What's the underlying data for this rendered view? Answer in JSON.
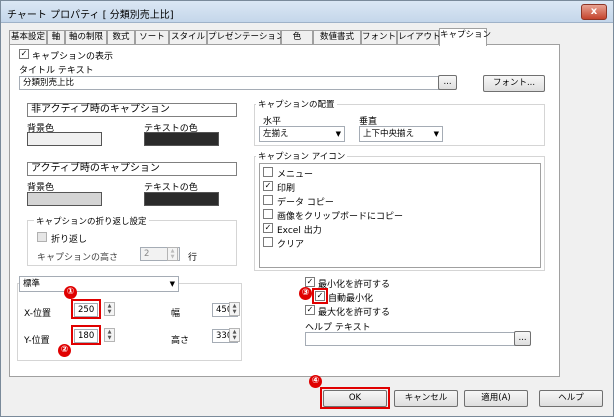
{
  "window": {
    "title": "チャート プロパティ [ 分類別売上比]",
    "close": "x"
  },
  "tabs": [
    "基本設定",
    "軸",
    "軸の制限",
    "数式",
    "ソート",
    "スタイル",
    "プレゼンテーション",
    "色",
    "数値書式",
    "フォント",
    "レイアウト",
    "キャプション"
  ],
  "caption": {
    "show_caption_label": "キャプションの表示",
    "show_caption_checked": "✓",
    "title_text_label": "タイトル テキスト",
    "title_text_value": "分類別売上比",
    "browse": "...",
    "font_button": "フォント..."
  },
  "inactive": {
    "heading": "非アクティブ時のキャプション",
    "bg_label": "背景色",
    "text_label": "テキストの色",
    "bg_color": "#f0f0f0",
    "text_color": "#2b2b2b"
  },
  "active": {
    "heading": "アクティブ時のキャプション",
    "bg_label": "背景色",
    "text_label": "テキストの色",
    "bg_color": "#d4d4d4",
    "text_color": "#2b2b2b"
  },
  "wrap": {
    "group_label": "キャプションの折り返し設定",
    "wrap_label": "折り返し",
    "height_label": "キャプションの高さ",
    "height_value": "2",
    "unit": "行"
  },
  "alignment": {
    "group_label": "キャプションの配置",
    "horizontal_label": "水平",
    "vertical_label": "垂直",
    "horizontal_value": "左揃え",
    "vertical_value": "上下中央揃え"
  },
  "icons": {
    "group_label": "キャプション アイコン",
    "items": [
      {
        "label": "メニュー",
        "check": ""
      },
      {
        "label": "印刷",
        "check": "✓"
      },
      {
        "label": "データ コピー",
        "check": ""
      },
      {
        "label": "画像をクリップボードにコピー",
        "check": ""
      },
      {
        "label": "Excel 出力",
        "check": "✓"
      },
      {
        "label": "クリア",
        "check": ""
      }
    ]
  },
  "position": {
    "mode": "標準",
    "x_label": "X-位置",
    "x_value": "250",
    "y_label": "Y-位置",
    "y_value": "180",
    "width_label": "幅",
    "width_value": "450",
    "height_label": "高さ",
    "height_value": "330"
  },
  "options": {
    "allow_minimize": {
      "label": "最小化を許可する",
      "check": "✓"
    },
    "auto_minimize": {
      "label": "自動最小化",
      "check": "✓"
    },
    "allow_maximize": {
      "label": "最大化を許可する",
      "check": "✓"
    },
    "help_text_label": "ヘルプ テキスト",
    "help_text_value": "",
    "browse": "..."
  },
  "markers": [
    "①",
    "②",
    "③",
    "④"
  ],
  "buttons": {
    "ok": "OK",
    "cancel": "キャンセル",
    "apply": "適用(A)",
    "help": "ヘルプ"
  },
  "colors": {
    "annotation_red": "#e00000"
  }
}
